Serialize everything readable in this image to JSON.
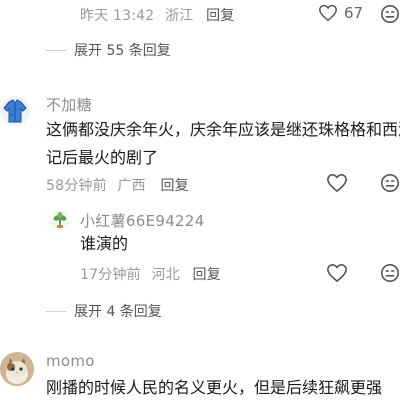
{
  "comment_top": {
    "time": "昨天 13:42",
    "location": "浙江",
    "reply_label": "回复",
    "like_count": "67",
    "expand_label": "展开 55 条回复"
  },
  "comment_2": {
    "username": "不加糖",
    "content_line1": "这俩都没庆余年火，庆余年应该是继还珠格格和西游",
    "content_line2": "记后最火的剧了",
    "time": "58分钟前",
    "location": "广西",
    "reply_label": "回复",
    "reply": {
      "username": "小红薯66E94224",
      "content": "谁演的",
      "time": "17分钟前",
      "location": "河北",
      "reply_label": "回复"
    },
    "expand_label": "展开 4 条回复"
  },
  "comment_3": {
    "username": "momo",
    "content": "刚播的时候人民的名义更火，但是后续狂飙更强"
  },
  "colors": {
    "accent_jacket": "#3b7fd9",
    "meta_gray": "#9a9a9a"
  }
}
